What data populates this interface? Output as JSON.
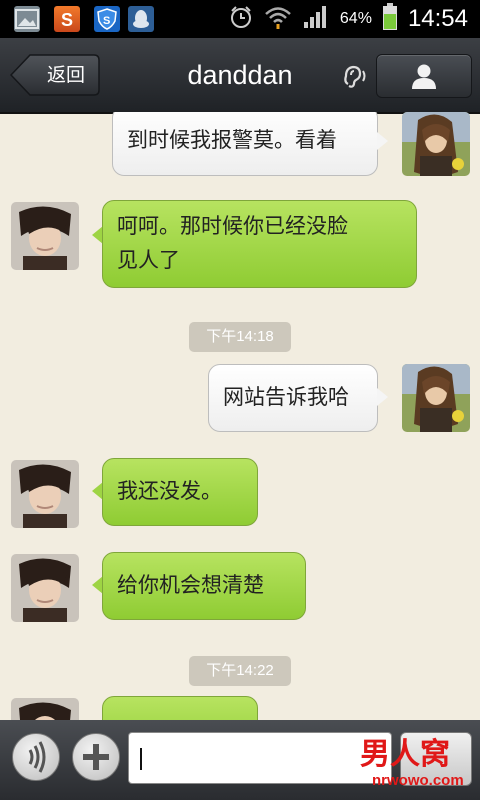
{
  "status_bar": {
    "battery_percent": "64%",
    "time": "14:54",
    "icons": [
      "gallery-icon",
      "app-s-icon",
      "shield-icon",
      "qq-icon",
      "alarm-icon",
      "wifi-icon",
      "signal-icon",
      "battery-icon"
    ]
  },
  "header": {
    "back_label": "返回",
    "title": "danddan",
    "earpiece_icon": "earpiece-icon",
    "profile_icon": "person-icon"
  },
  "messages": [
    {
      "side": "right",
      "text": "到时候我报警莫。看着"
    },
    {
      "side": "left",
      "text_line1": "呵呵。那时候你已经没脸",
      "text_line2": "见人了"
    },
    {
      "type": "timestamp",
      "text": "下午14:18"
    },
    {
      "side": "right",
      "text": "网站告诉我哈"
    },
    {
      "side": "left",
      "text": "我还没发。"
    },
    {
      "side": "left",
      "text": "给你机会想清楚"
    },
    {
      "type": "timestamp",
      "text": "下午14:22"
    }
  ],
  "input_bar": {
    "voice_icon": "voice-icon",
    "plus_icon": "plus-icon",
    "message_value": "",
    "send_label": ""
  },
  "watermark": {
    "logo_text": "男人窝",
    "site_text": "nrwowo.com"
  },
  "colors": {
    "chat_background": "#f2ede0",
    "sent_bubble": "#ffffff",
    "received_bubble": "#9ed444",
    "header_bar": "#2b2e33"
  }
}
